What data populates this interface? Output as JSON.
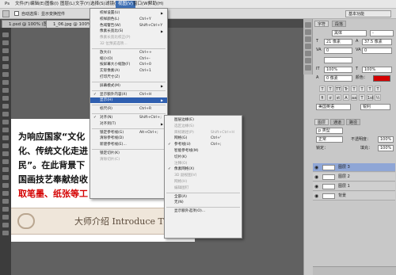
{
  "menubar": [
    "Ps",
    "文件(F)",
    "编辑(E)",
    "图像(I)",
    "图层(L)",
    "文字(Y)",
    "选择(S)",
    "滤镜(T)",
    "视图(V)",
    "窗口(W)",
    "帮助(H)"
  ],
  "optbar": {
    "checkbox_label": "自动选择：",
    "select_value": "图层",
    "show_transform": "显示变换控件",
    "workspace": "基本功能"
  },
  "tabs": [
    "1.psd @ 100% (图层...",
    "1_06.jpg @ 100% (图层..."
  ],
  "document": {
    "line1": "为响应国家“文化",
    "line2": "化、传统文化走进",
    "line3": "民”。在此背景下",
    "line4": "国画技艺奉献给收",
    "line5": "取笔墨、纸张等工",
    "banner_text": "大师介绍  Introduce The"
  },
  "view_menu": [
    {
      "t": "校样设置(U)",
      "k": "",
      "arrow": true
    },
    {
      "t": "校样颜色(L)",
      "k": "Ctrl+Y"
    },
    {
      "t": "色域警告(W)",
      "k": "Shift+Ctrl+Y"
    },
    {
      "t": "像素长宽比(S)",
      "k": "",
      "arrow": true
    },
    {
      "t": "像素长宽比校正(P)",
      "k": "",
      "dis": true
    },
    {
      "t": "32 位预览选项...",
      "k": "",
      "dis": true
    },
    {
      "sep": true
    },
    {
      "t": "放大(I)",
      "k": "Ctrl++"
    },
    {
      "t": "缩小(O)",
      "k": "Ctrl+-"
    },
    {
      "t": "按屏幕大小缩放(F)",
      "k": "Ctrl+0"
    },
    {
      "t": "实际像素(A)",
      "k": "Ctrl+1"
    },
    {
      "t": "打印尺寸(Z)",
      "k": ""
    },
    {
      "sep": true
    },
    {
      "t": "屏幕模式(M)",
      "k": "",
      "arrow": true
    },
    {
      "sep": true
    },
    {
      "t": "显示额外内容(X)",
      "k": "Ctrl+H",
      "chk": true
    },
    {
      "t": "显示(H)",
      "k": "",
      "arrow": true,
      "hl": true
    },
    {
      "sep": true
    },
    {
      "t": "标尺(R)",
      "k": "Ctrl+R"
    },
    {
      "sep": true
    },
    {
      "t": "对齐(N)",
      "k": "Shift+Ctrl+;",
      "chk": true
    },
    {
      "t": "对齐到(T)",
      "k": "",
      "arrow": true
    },
    {
      "sep": true
    },
    {
      "t": "锁定参考线(G)",
      "k": "Alt+Ctrl+;"
    },
    {
      "t": "清除参考线(D)",
      "k": ""
    },
    {
      "t": "新建参考线(E)...",
      "k": ""
    },
    {
      "sep": true
    },
    {
      "t": "锁定切片(K)",
      "k": ""
    },
    {
      "t": "清除切片(C)",
      "k": "",
      "dis": true
    }
  ],
  "show_submenu": [
    {
      "t": "图层边缘(E)",
      "k": ""
    },
    {
      "t": "选区边缘(S)",
      "k": "",
      "dis": true
    },
    {
      "t": "目标路径(P)",
      "k": "Shift+Ctrl+H",
      "dis": true
    },
    {
      "t": "网格(G)",
      "k": "Ctrl+'"
    },
    {
      "t": "参考线(U)",
      "k": "Ctrl+;",
      "chk": true
    },
    {
      "t": "智能参考线(M)",
      "k": ""
    },
    {
      "t": "切片(K)",
      "k": ""
    },
    {
      "t": "注释(O)",
      "k": "",
      "dis": true
    },
    {
      "t": "像素网格(X)",
      "k": "",
      "chk": true
    },
    {
      "t": "3D 副视图(V)",
      "k": "",
      "dis": true
    },
    {
      "t": "网格(H)",
      "k": "",
      "dis": true
    },
    {
      "t": "编辑图钉",
      "k": "",
      "dis": true
    },
    {
      "sep": true
    },
    {
      "t": "全部(A)",
      "k": ""
    },
    {
      "t": "无(N)",
      "k": ""
    },
    {
      "sep": true
    },
    {
      "t": "显示额外选项(O)...",
      "k": ""
    }
  ],
  "char_panel": {
    "tab1": "字符",
    "tab2": "段落",
    "font_family": "黑体",
    "font_style": "-",
    "size": "21 像素",
    "leading": "37.5 像素",
    "kerning": "0",
    "tracking": "0",
    "vscale": "100%",
    "hscale": "100%",
    "baseline": "0 像素",
    "color_label": "颜色：",
    "language": "美国英语",
    "aa": "锐利",
    "color_hex": "#d40000"
  },
  "layers_panel": {
    "tab1": "图层",
    "tab2": "通道",
    "tab3": "路径",
    "kind": "p 类型",
    "blend": "正常",
    "opacity_label": "不透明度：",
    "opacity": "100%",
    "lock_label": "锁定：",
    "fill_label": "填充：",
    "fill": "100%",
    "layers": [
      "图层 3",
      "图层 2",
      "图层 1",
      "背景"
    ]
  }
}
